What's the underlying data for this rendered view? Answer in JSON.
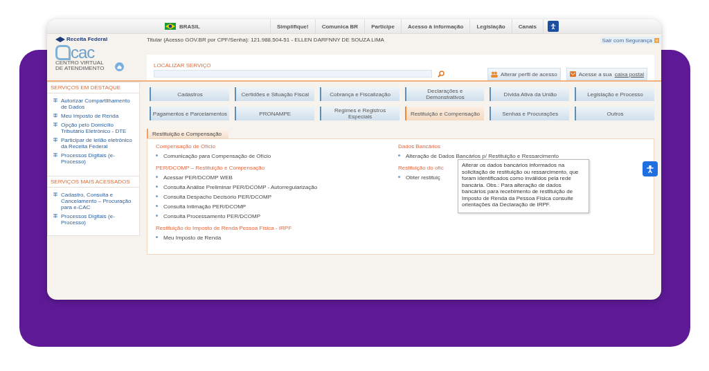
{
  "gov_bar": {
    "country": "BRASIL",
    "links": [
      "Simplifique!",
      "Comunica BR",
      "Participe",
      "Acesso à informação",
      "Legislação",
      "Canais"
    ]
  },
  "header": {
    "brand": "Receita Federal",
    "logo_text": "cac",
    "logo_subtitle": "CENTRO VIRTUAL DE ATENDIMENTO",
    "user": "Titular (Acesso GOV.BR por CPF/Senha): 121.988.504-51 - ELLEN DARFNNY DE SOUZA LIMA",
    "logout": "Sair com Segurança"
  },
  "search": {
    "label": "LOCALIZAR SERVIÇO",
    "profile_button": "Alterar perfil de acesso",
    "mailbox_prefix": "Acesse a sua",
    "mailbox_link": "caixa postal"
  },
  "sidebar": [
    {
      "title": "SERVIÇOS EM DESTAQUE",
      "items": [
        "Autorizar Compartilhamento de Dados",
        "Meu Imposto de Renda",
        "Opção pelo Domicílio Tributário Eletrônico - DTE",
        "Participar de leilão eletrônico da Receita Federal",
        "Processos Digitais (e-Processo)"
      ]
    },
    {
      "title": "SERVIÇOS MAIS ACESSADOS",
      "items": [
        "Cadastro, Consulta e Cancelamento – Procuração para e-CAC",
        "Processos Digitais (e-Processo)"
      ]
    }
  ],
  "categories": [
    {
      "label": "Cadastros",
      "selected": false
    },
    {
      "label": "Certidões e Situação Fiscal",
      "selected": false
    },
    {
      "label": "Cobrança e Fiscalização",
      "selected": false
    },
    {
      "label": "Declarações e Demonstrativos",
      "selected": false
    },
    {
      "label": "Dívida Ativa da União",
      "selected": false
    },
    {
      "label": "Legislação e Processo",
      "selected": false
    },
    {
      "label": "Pagamentos e Parcelamentos",
      "selected": false
    },
    {
      "label": "PRONAMPE",
      "selected": false
    },
    {
      "label": "Regimes e Registros Especiais",
      "selected": false
    },
    {
      "label": "Restituição e Compensação",
      "selected": true
    },
    {
      "label": "Senhas e Procurações",
      "selected": false
    },
    {
      "label": "Outros",
      "selected": false
    }
  ],
  "panel": {
    "tab": "Restituição e Compensação",
    "columns": [
      [
        {
          "heading": "Compensação de Ofício",
          "items": [
            "Comunicação para Compensação de Ofício"
          ]
        },
        {
          "heading": "PER/DCOMP – Restituição e Compensação",
          "items": [
            "Acessar PER/DCOMP WEB",
            "Consulta Análise Preliminar PER/DCOMP - Autorregularização",
            "Consulta Despacho Decisório PER/DCOMP",
            "Consulta Intimação PER/DCOMP",
            "Consulta Processamento PER/DCOMP"
          ]
        },
        {
          "heading": "Restituição do Imposto de Renda Pessoa Física - IRPF",
          "items": [
            "Meu Imposto de Renda"
          ]
        }
      ],
      [
        {
          "heading": "Dados Bancários",
          "items": [
            "Alteração de Dados Bancários p/ Restituição e Ressarcimento"
          ]
        },
        {
          "heading": "Restituição do ofíc",
          "items": [
            "Obter restituiç"
          ]
        }
      ]
    ]
  },
  "tooltip": "Alterar os dados bancários informados na solicitação de restituição ou ressarcimento, que foram identificados como inválidos pela rede bancária. Obs.: Para alteração de dados bancários para recebimento de restituição de Imposto de Renda da Pessoa Física consulte orientações da Declaração de IRPF."
}
